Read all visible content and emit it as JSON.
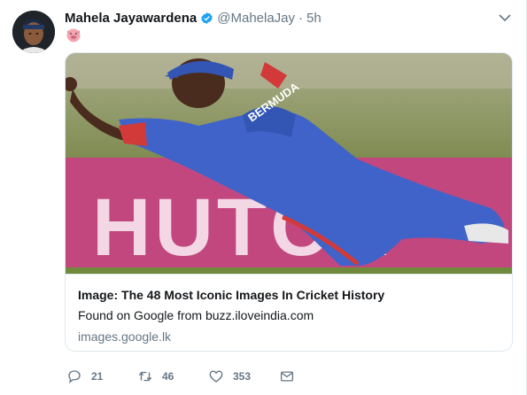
{
  "tweet": {
    "author_name": "Mahela Jayawardena",
    "author_handle": "@MahelaJay",
    "separator": "·",
    "timestamp": "5h",
    "emoji": "pig-face-emoji"
  },
  "card": {
    "title": "Image: The 48 Most Iconic Images In Cricket History",
    "description": "Found on Google from buzz.iloveindia.com",
    "domain": "images.google.lk",
    "image_banner_text": "HUTCH",
    "image_jersey_text": "BERMUDA"
  },
  "actions": {
    "replies": "21",
    "retweets": "46",
    "likes": "353"
  },
  "colors": {
    "verified": "#1da1f2",
    "secondary_text": "#657786",
    "border": "#e1e8ed",
    "banner_magenta": "#c2477f",
    "jersey_blue": "#3f63c9"
  }
}
